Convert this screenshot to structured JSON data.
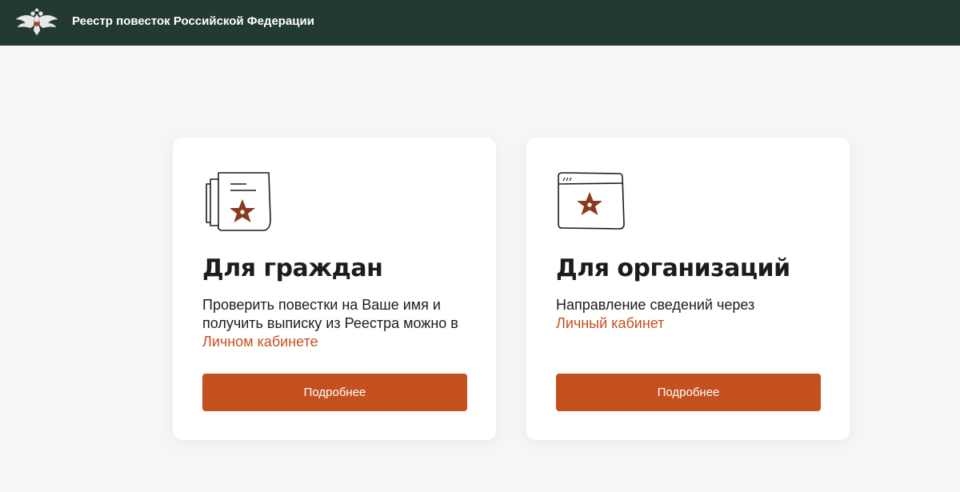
{
  "header": {
    "title": "Реестр повесток Российской Федерации",
    "logo_icon": "double-headed-eagle-emblem"
  },
  "colors": {
    "header_bg": "#233a33",
    "accent": "#c5501f",
    "page_bg": "#f6f6f6",
    "card_bg": "#ffffff",
    "star": "#8a3a1e"
  },
  "cards": [
    {
      "icon": "document-star-icon",
      "title": "Для граждан",
      "text_before": "Проверить повестки на Ваше имя и получить выписку из Реестра можно в ",
      "link": "Личном кабинете",
      "button": "Подробнее"
    },
    {
      "icon": "browser-window-star-icon",
      "title": "Для организаций",
      "text_before": "Направление сведений через ",
      "link": "Личный кабинет",
      "button": "Подробнее"
    }
  ]
}
